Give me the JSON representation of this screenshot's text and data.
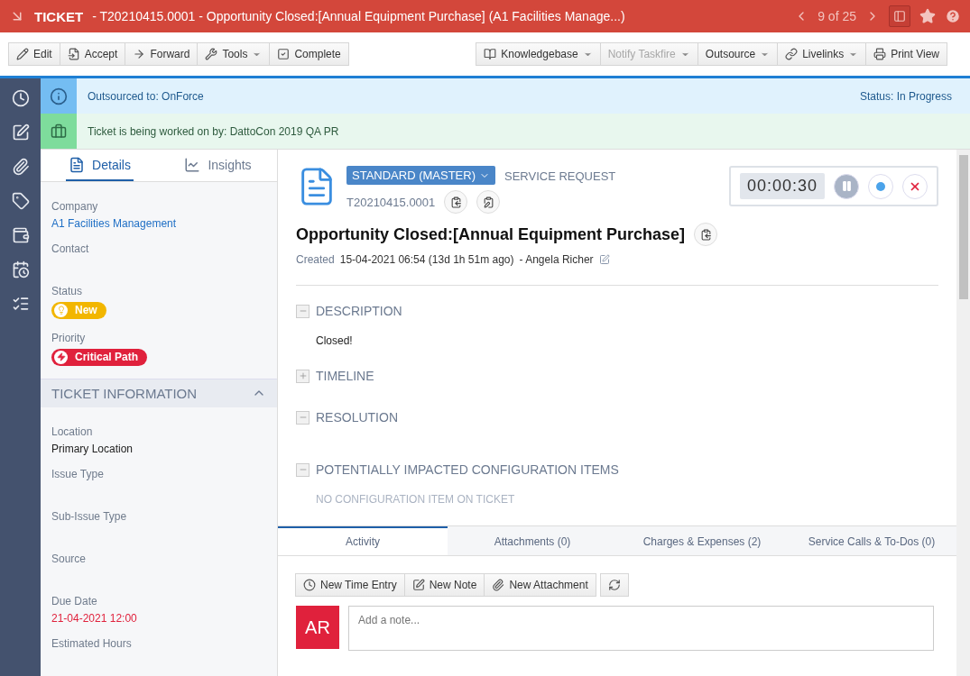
{
  "header": {
    "label": "TICKET",
    "title": "- T20210415.0001 - Opportunity Closed:[Annual Equipment Purchase] (A1 Facilities Manage...)",
    "pager": "9 of 25"
  },
  "toolbar": {
    "left": [
      {
        "label": "Edit",
        "kind": "pencil",
        "dropdown": false,
        "disabled": false
      },
      {
        "label": "Accept",
        "kind": "accept",
        "dropdown": false,
        "disabled": false
      },
      {
        "label": "Forward",
        "kind": "forward",
        "dropdown": false,
        "disabled": false
      },
      {
        "label": "Tools",
        "kind": "tools",
        "dropdown": true,
        "disabled": false
      },
      {
        "label": "Complete",
        "kind": "check",
        "dropdown": false,
        "disabled": false
      }
    ],
    "right": [
      {
        "label": "Knowledgebase",
        "kind": "book",
        "dropdown": true,
        "disabled": false
      },
      {
        "label": "Notify Taskfire",
        "kind": "plain",
        "dropdown": true,
        "disabled": true
      },
      {
        "label": "Outsource",
        "kind": "plain",
        "dropdown": true,
        "disabled": false
      },
      {
        "label": "Livelinks",
        "kind": "link",
        "dropdown": true,
        "disabled": false
      },
      {
        "label": "Print View",
        "kind": "printer",
        "dropdown": false,
        "disabled": false
      }
    ]
  },
  "banners": [
    {
      "kind": "info",
      "text": "Outsourced to: OnForce",
      "status": "Status: In Progress"
    },
    {
      "kind": "worker",
      "text": "Ticket is being worked on by: DattoCon 2019 QA PR"
    }
  ],
  "sidebar": {
    "tabs": [
      {
        "label": "Details",
        "selected": true
      },
      {
        "label": "Insights",
        "selected": false
      }
    ],
    "fields": [
      {
        "label": "Company",
        "kind": "link",
        "value": "A1 Facilities Management"
      },
      {
        "label": "Contact",
        "kind": "empty"
      },
      {
        "label": "Status",
        "kind": "badge",
        "value": "New",
        "color": "#f2b600"
      },
      {
        "label": "Priority",
        "kind": "badge",
        "value": "Critical Path",
        "color": "#e0213c"
      }
    ],
    "section": {
      "title": "TICKET INFORMATION",
      "expanded": true,
      "fields": [
        {
          "label": "Location",
          "kind": "text",
          "value": "Primary Location"
        },
        {
          "label": "Issue Type",
          "kind": "empty"
        },
        {
          "label": "Sub-Issue Type",
          "kind": "empty"
        },
        {
          "label": "Source",
          "kind": "empty"
        },
        {
          "label": "Due Date",
          "kind": "overdue",
          "value": "21-04-2021 12:00"
        },
        {
          "label": "Estimated Hours",
          "kind": "empty"
        }
      ]
    }
  },
  "ticket": {
    "category": "STANDARD (MASTER)",
    "type": "SERVICE REQUEST",
    "number": "T20210415.0001",
    "title": "Opportunity Closed:[Annual Equipment Purchase]",
    "created_label": "Created",
    "created": "15-04-2021 06:54 (13d 1h 51m ago)",
    "creator": "- Angela Richer",
    "timer": "00:00:30"
  },
  "sections": [
    {
      "title": "DESCRIPTION",
      "expanded": true,
      "body": "Closed!"
    },
    {
      "title": "TIMELINE",
      "expanded": false
    },
    {
      "title": "RESOLUTION",
      "expanded": true
    },
    {
      "title": "POTENTIALLY IMPACTED CONFIGURATION ITEMS",
      "expanded": true,
      "empty_text": "NO CONFIGURATION ITEM ON TICKET"
    }
  ],
  "tabs": [
    {
      "label": "Activity",
      "selected": true
    },
    {
      "label": "Attachments (0)",
      "selected": false
    },
    {
      "label": "Charges & Expenses (2)",
      "selected": false
    },
    {
      "label": "Service Calls & To-Dos (0)",
      "selected": false
    }
  ],
  "activity": {
    "buttons": [
      {
        "label": "New Time Entry",
        "kind": "clock"
      },
      {
        "label": "New Note",
        "kind": "note"
      },
      {
        "label": "New Attachment",
        "kind": "clip"
      }
    ],
    "avatar": "AR",
    "note_placeholder": "Add a note..."
  }
}
